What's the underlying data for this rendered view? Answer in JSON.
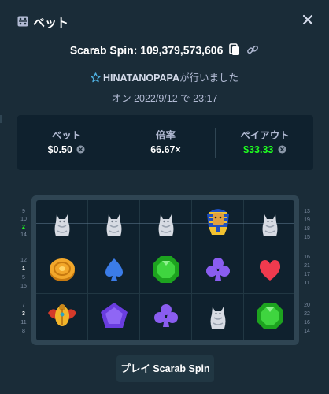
{
  "header": {
    "title": "ベット",
    "title_icon": "dice-icon",
    "close_icon": "close-icon"
  },
  "spin": {
    "label": "Scarab Spin: 109,379,573,606",
    "icons": [
      "copy-icon",
      "link-icon"
    ]
  },
  "player": {
    "star_icon": "star-icon",
    "name": "HINATANOPAPA",
    "suffix": "が行いました"
  },
  "date": {
    "text": "オン 2022/9/12 で 23:17"
  },
  "stats": {
    "bet": {
      "label": "ベット",
      "value": "$0.50"
    },
    "multiplier": {
      "label": "倍率",
      "value": "66.67×"
    },
    "payout": {
      "label": "ペイアウト",
      "value": "$33.33"
    }
  },
  "colors": {
    "background": "#1a2c38",
    "panel": "#0f212e",
    "payout_green": "#1fff20",
    "muted": "#b1bad3"
  },
  "board": {
    "rows": [
      [
        "cat-statue-icon",
        "cat-statue-icon",
        "cat-statue-icon",
        "pharaoh-icon",
        "cat-statue-icon"
      ],
      [
        "gold-coin-icon",
        "blue-spade-icon",
        "green-gem-icon",
        "purple-club-icon",
        "red-heart-icon"
      ],
      [
        "scarab-icon",
        "purple-pentagon-gem-icon",
        "purple-club-icon",
        "cat-statue-icon",
        "green-gem-icon"
      ]
    ],
    "left_numbers": [
      [
        "9",
        "10",
        "2",
        "14"
      ],
      [
        "12",
        "1",
        "5",
        "15"
      ],
      [
        "7",
        "3",
        "11",
        "8"
      ]
    ],
    "right_numbers": [
      [
        "13",
        "19",
        "18",
        "15"
      ],
      [
        "16",
        "21",
        "17",
        "11"
      ],
      [
        "20",
        "22",
        "16",
        "14"
      ]
    ]
  },
  "play_button": {
    "label": "プレイ Scarab Spin"
  }
}
